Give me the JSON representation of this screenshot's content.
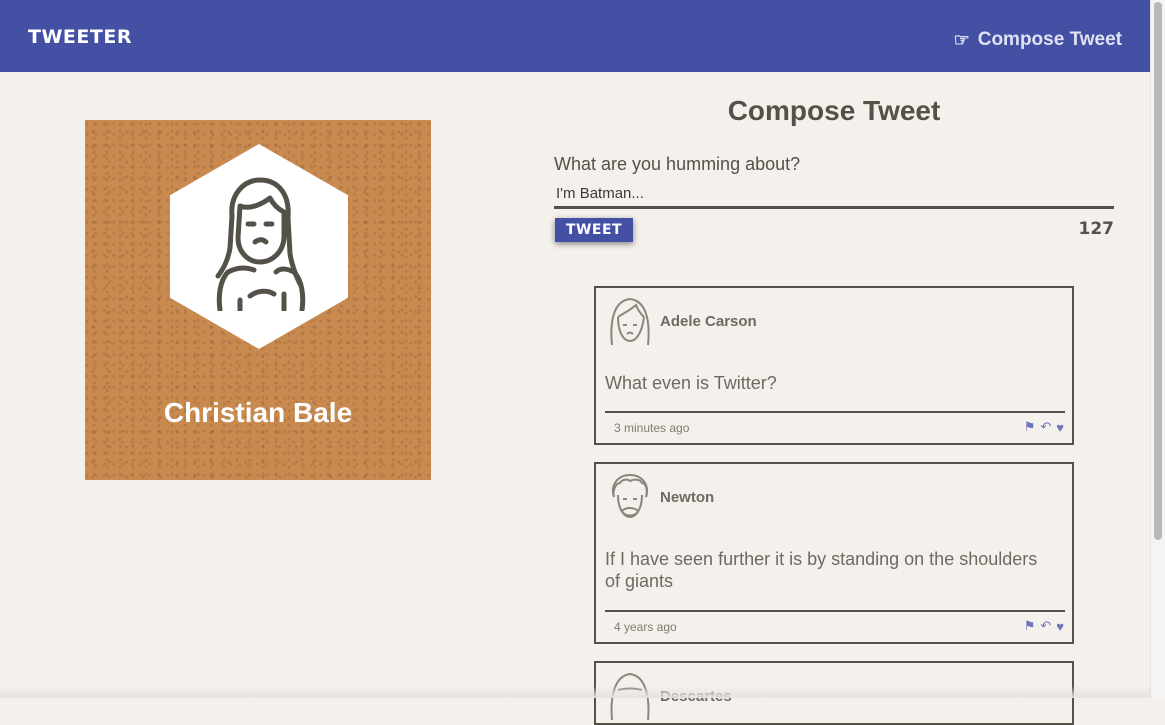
{
  "nav": {
    "brand": "TWEETER",
    "compose_label": "Compose Tweet",
    "compose_icon": "pointing-hand-icon"
  },
  "profile": {
    "name": "Christian Bale",
    "avatar_icon": "user-avatar-icon"
  },
  "compose": {
    "title": "Compose Tweet",
    "prompt": "What are you humming about?",
    "input_value": "I'm Batman...",
    "button_label": "TWEET",
    "counter": "127"
  },
  "tweets": [
    {
      "author": "Adele Carson",
      "text": "What even is Twitter?",
      "time": "3 minutes ago"
    },
    {
      "author": "Newton",
      "text": "If I have seen further it is by standing on the shoulders of giants",
      "time": "4 years ago"
    },
    {
      "author": "Descartes"
    }
  ],
  "colors": {
    "nav": "#4450a4",
    "background": "#f4f1ec",
    "profile_bg": "#c98a50",
    "text": "#545149",
    "action": "#6c73bf"
  }
}
